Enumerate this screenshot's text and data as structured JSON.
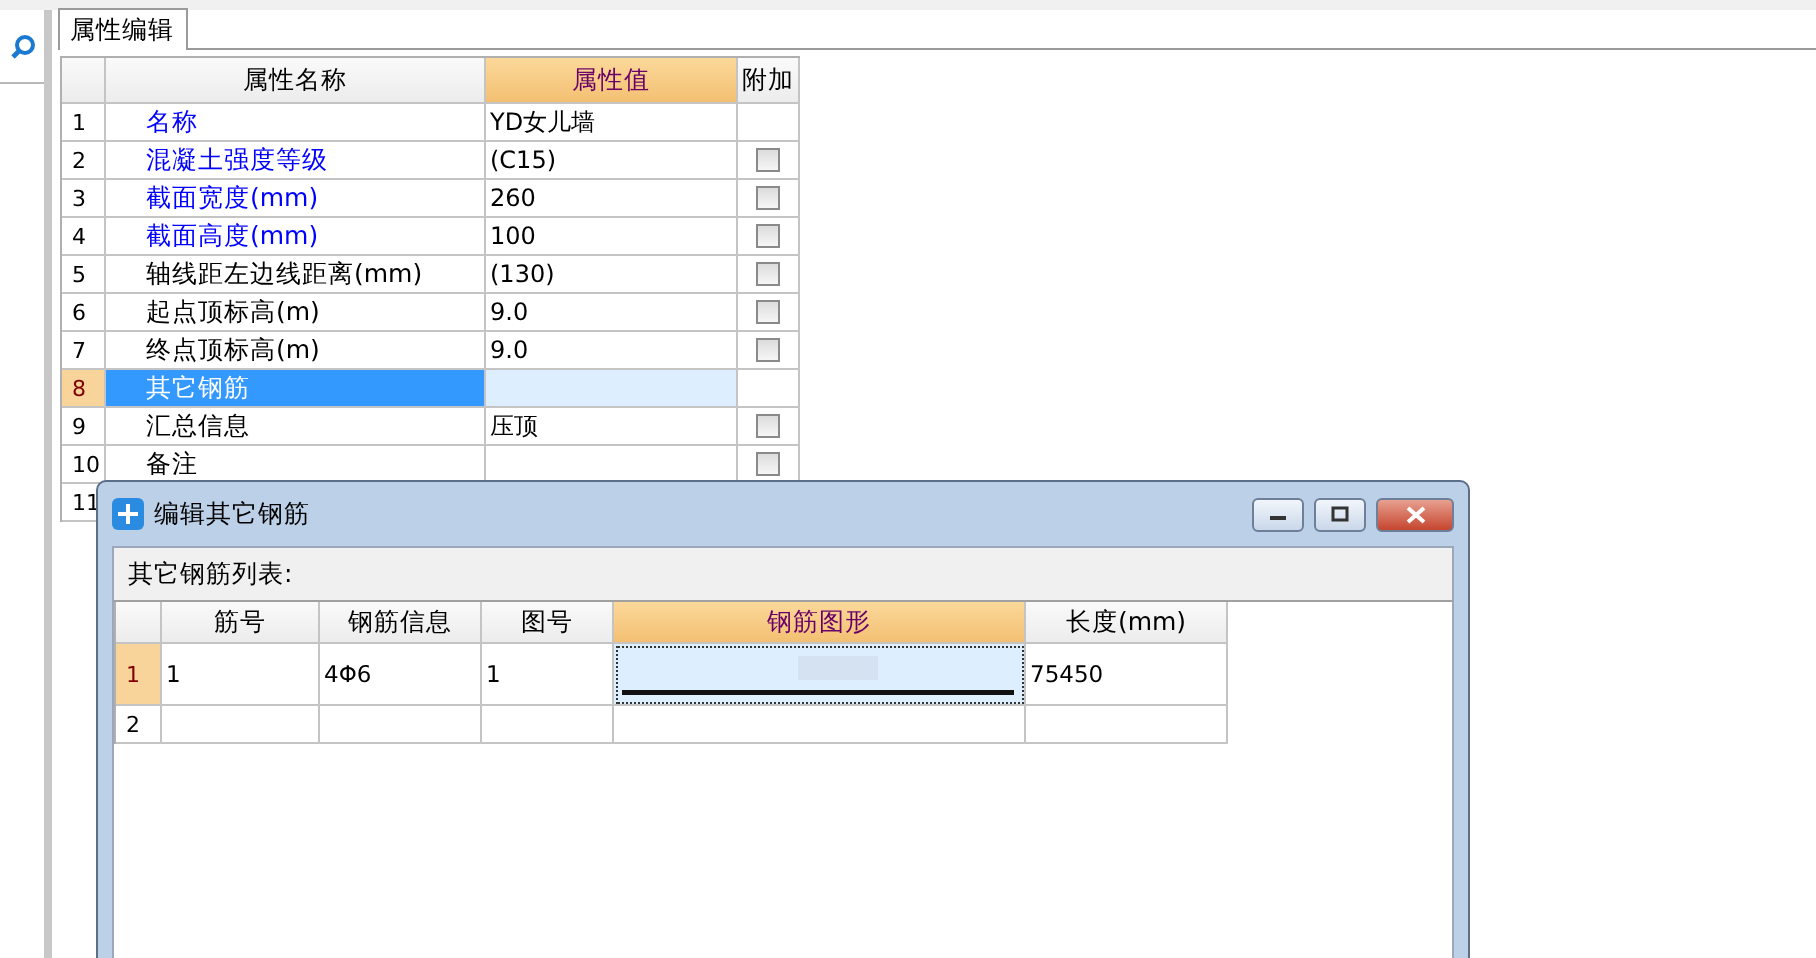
{
  "tab": {
    "label": "属性编辑",
    "selected": true
  },
  "property_table": {
    "columns": [
      "属性名称",
      "属性值",
      "附加"
    ],
    "rows": [
      {
        "number": "1",
        "name": "名称",
        "value": "YD女儿墙",
        "color": "#0000ff",
        "selected": false
      },
      {
        "number": "2",
        "name": "混凝土强度等级",
        "value": "(C15)",
        "color": "#0000ff",
        "selected": false,
        "checked": false
      },
      {
        "number": "3",
        "name": "截面宽度(mm)",
        "value": "260",
        "color": "#0000ff",
        "selected": false,
        "checked": false
      },
      {
        "number": "4",
        "name": "截面高度(mm)",
        "value": "100",
        "color": "#0000ff",
        "selected": false,
        "checked": false
      },
      {
        "number": "5",
        "name": "轴线距左边线距离(mm)",
        "value": "(130)",
        "color": "#000000",
        "selected": false,
        "checked": false
      },
      {
        "number": "6",
        "name": "起点顶标高(m)",
        "value": "9.0",
        "color": "#000000",
        "selected": false,
        "checked": false
      },
      {
        "number": "7",
        "name": "终点顶标高(m)",
        "value": "9.0",
        "color": "#000000",
        "selected": false,
        "checked": false
      },
      {
        "number": "8",
        "name": "其它钢筋",
        "value": "",
        "selected": true
      },
      {
        "number": "9",
        "name": "汇总信息",
        "value": "压顶",
        "color": "#000000",
        "selected": false,
        "checked": false
      },
      {
        "number": "10",
        "name": "备注",
        "value": "",
        "color": "#000000",
        "selected": false,
        "checked": false
      },
      {
        "number": "11",
        "name": "",
        "value": "",
        "selected": false
      }
    ]
  },
  "dialog": {
    "title": "编辑其它钢筋",
    "list_label": "其它钢筋列表:",
    "columns": [
      "筋号",
      "钢筋信息",
      "图号",
      "钢筋图形",
      "长度(mm)"
    ],
    "rows": [
      {
        "number": "1",
        "selected": true,
        "cells": [
          "1",
          "4Φ6",
          "1"
        ],
        "has_shape": true,
        "length": "75450"
      },
      {
        "number": "2",
        "selected": false,
        "cells": [
          "",
          "",
          ""
        ],
        "has_shape": false,
        "length": ""
      }
    ]
  }
}
